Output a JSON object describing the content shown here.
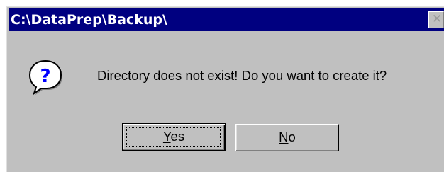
{
  "window": {
    "title": "C:\\DataPrep\\Backup\\",
    "close_glyph": "✕"
  },
  "dialog": {
    "icon": "question-icon",
    "message": "Directory does not exist!  Do you want to create it?"
  },
  "buttons": {
    "yes": {
      "mnemonic": "Y",
      "rest": "es"
    },
    "no": {
      "mnemonic": "N",
      "rest": "o"
    }
  },
  "colors": {
    "titlebar": "#000080",
    "face": "#c0c0c0",
    "icon_fill": "#ffffff",
    "icon_glyph": "#0000ff"
  }
}
